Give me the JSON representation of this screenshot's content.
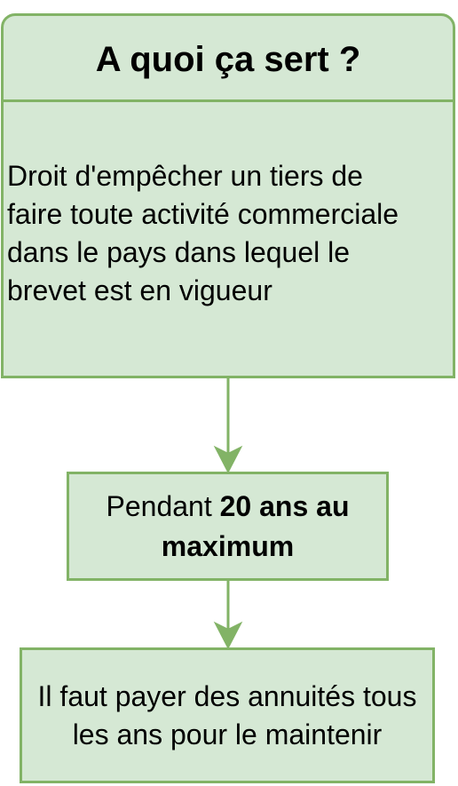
{
  "colors": {
    "fill": "#d5e8d4",
    "stroke": "#82b366",
    "text": "#000000"
  },
  "top": {
    "title": "A quoi ça sert ?",
    "body_lines": [
      "Droit d'empêcher un tiers de",
      "faire toute activité commerciale",
      "dans le pays dans lequel le",
      "brevet est en vigueur"
    ]
  },
  "middle": {
    "prefix": "Pendant ",
    "bold": "20 ans au maximum"
  },
  "bottom": {
    "text": "Il faut payer des annuités tous les ans pour le maintenir"
  }
}
